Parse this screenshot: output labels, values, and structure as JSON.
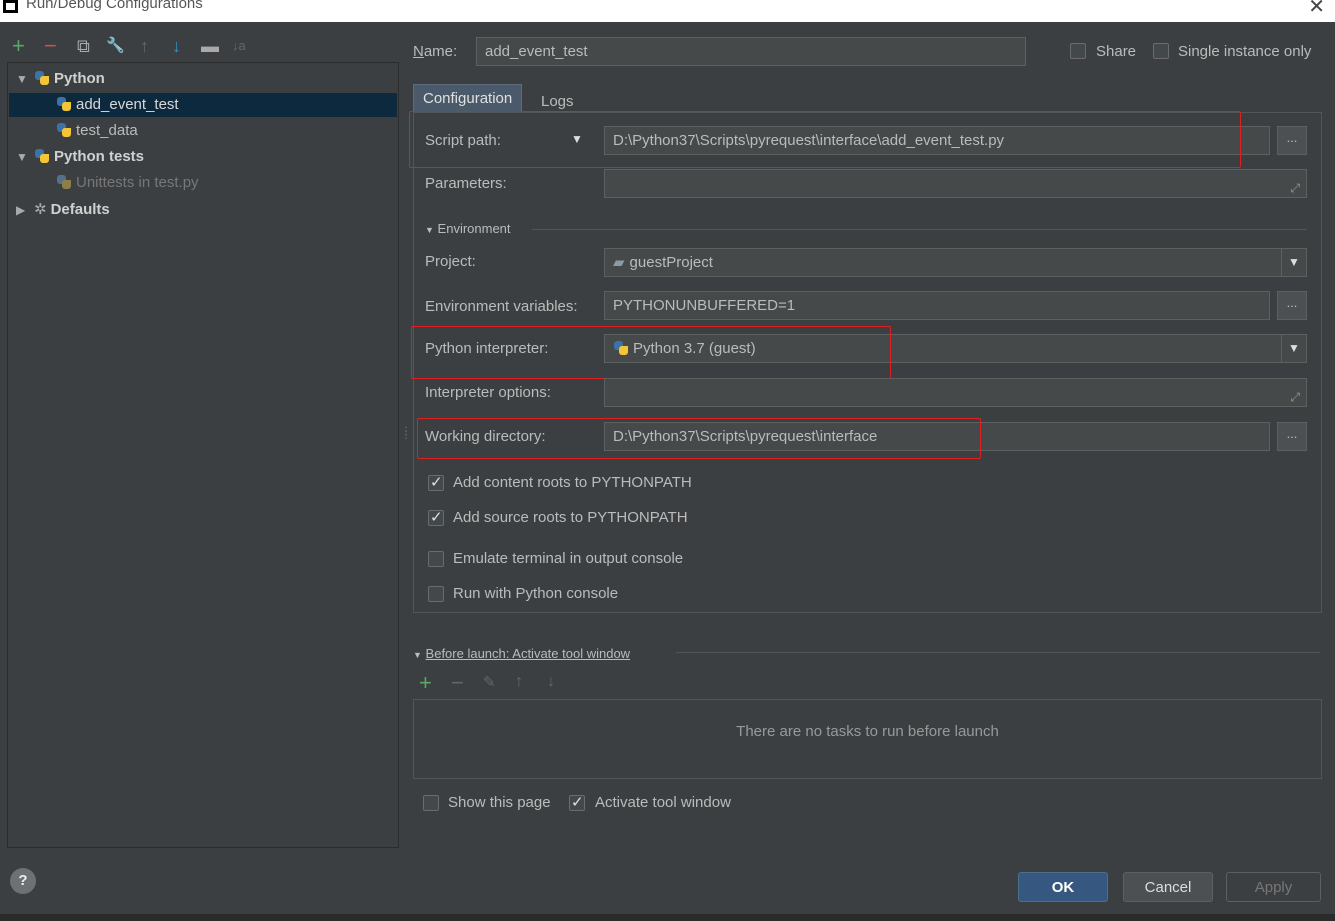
{
  "window": {
    "title": "Run/Debug Configurations"
  },
  "toolbar": {
    "add": "+",
    "remove": "−",
    "copy": "⧉",
    "edit": "🔧",
    "up": "↑",
    "down": "↓",
    "folder": "▬",
    "sort": "↓a"
  },
  "tree": {
    "python": "Python",
    "add_event_test": "add_event_test",
    "test_data": "test_data",
    "python_tests": "Python tests",
    "unittests": "Unittests in test.py",
    "defaults": "Defaults"
  },
  "header": {
    "name_label": "Name:",
    "name_value": "add_event_test",
    "share": "Share",
    "single_instance": "Single instance only"
  },
  "tabs": {
    "configuration": "Configuration",
    "logs": "Logs"
  },
  "config": {
    "script_path_label": "Script path:",
    "script_path_value": "D:\\Python37\\Scripts\\pyrequest\\interface\\add_event_test.py",
    "parameters_label": "Parameters:",
    "environment_header": "Environment",
    "project_label": "Project:",
    "project_value": "guestProject",
    "env_vars_label": "Environment variables:",
    "env_vars_value": "PYTHONUNBUFFERED=1",
    "interpreter_label": "Python interpreter:",
    "interpreter_value": "Python 3.7 (guest)",
    "interp_options_label": "Interpreter options:",
    "working_dir_label": "Working directory:",
    "working_dir_value": "D:\\Python37\\Scripts\\pyrequest\\interface",
    "add_content_roots": "Add content roots to PYTHONPATH",
    "add_source_roots": "Add source roots to PYTHONPATH",
    "emulate_terminal": "Emulate terminal in output console",
    "run_with_console": "Run with Python console",
    "dots": "..."
  },
  "before_launch": {
    "header": "Before launch: Activate tool window",
    "empty": "There are no tasks to run before launch",
    "show_page": "Show this page",
    "activate_tool_window": "Activate tool window"
  },
  "buttons": {
    "ok": "OK",
    "cancel": "Cancel",
    "apply": "Apply",
    "help": "?"
  },
  "colors": {
    "background": "#3c3f41",
    "selection": "#0d293e",
    "highlight": "#e02020",
    "ok": "#365880",
    "add": "#59a869",
    "remove": "#c75450",
    "arrow": "#3592c4"
  }
}
